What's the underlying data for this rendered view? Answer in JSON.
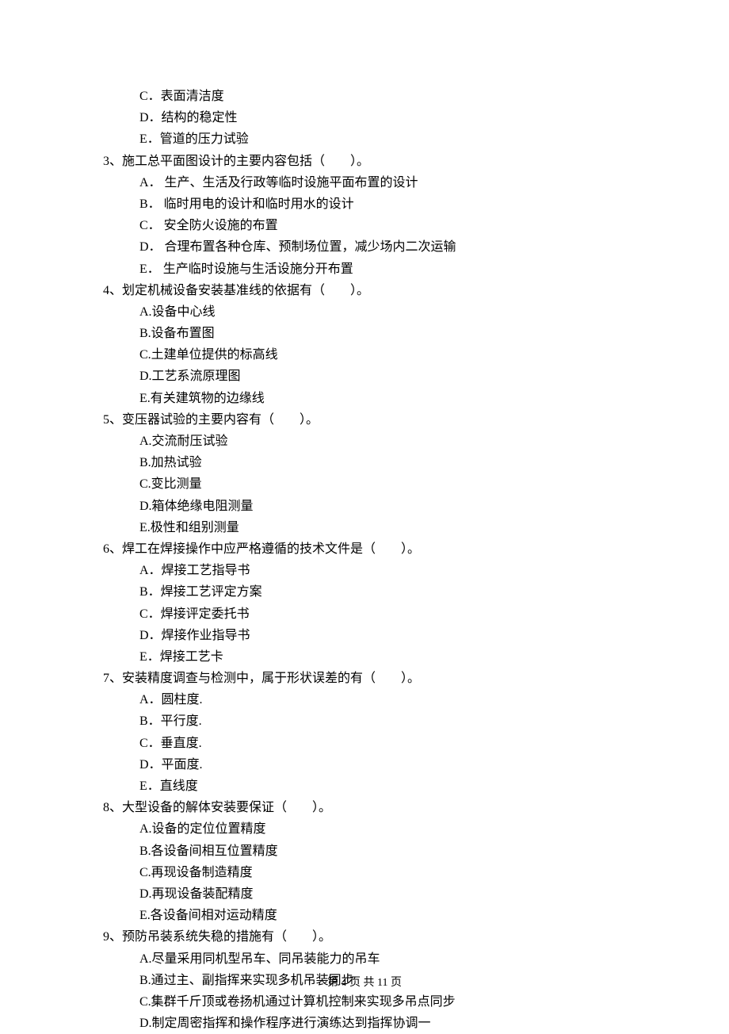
{
  "lines": {
    "opt_2c": "C．表面清洁度",
    "opt_2d": "D．结构的稳定性",
    "opt_2e": "E．管道的压力试验",
    "q3": "3、施工总平面图设计的主要内容包括（　　）。",
    "opt_3a": "A． 生产、生活及行政等临时设施平面布置的设计",
    "opt_3b": "B． 临时用电的设计和临时用水的设计",
    "opt_3c": "C． 安全防火设施的布置",
    "opt_3d": "D． 合理布置各种仓库、预制场位置，减少场内二次运输",
    "opt_3e": "E． 生产临时设施与生活设施分开布置",
    "q4": "4、划定机械设备安装基准线的依据有（　　）。",
    "opt_4a": "A.设备中心线",
    "opt_4b": "B.设备布置图",
    "opt_4c": "C.土建单位提供的标高线",
    "opt_4d": "D.工艺系流原理图",
    "opt_4e": "E.有关建筑物的边缘线",
    "q5": "5、变压器试验的主要内容有（　　）。",
    "opt_5a": "A.交流耐压试验",
    "opt_5b": "B.加热试验",
    "opt_5c": "C.变比测量",
    "opt_5d": "D.箱体绝缘电阻测量",
    "opt_5e": "E.极性和组别测量",
    "q6": "6、焊工在焊接操作中应严格遵循的技术文件是（　　）。",
    "opt_6a": "A．焊接工艺指导书",
    "opt_6b": "B．焊接工艺评定方案",
    "opt_6c": "C．焊接评定委托书",
    "opt_6d": "D．焊接作业指导书",
    "opt_6e": "E．焊接工艺卡",
    "q7": "7、安装精度调查与检测中，属于形状误差的有（　　）。",
    "opt_7a": "A．圆柱度.",
    "opt_7b": "B．平行度.",
    "opt_7c": "C．垂直度.",
    "opt_7d": "D．平面度.",
    "opt_7e": "E．直线度",
    "q8": "8、大型设备的解体安装要保证（　　）。",
    "opt_8a": "A.设备的定位位置精度",
    "opt_8b": "B.各设备间相互位置精度",
    "opt_8c": "C.再现设备制造精度",
    "opt_8d": "D.再现设备装配精度",
    "opt_8e": "E.各设备间相对运动精度",
    "q9": "9、预防吊装系统失稳的措施有（　　）。",
    "opt_9a": "A.尽量采用同机型吊车、同吊装能力的吊车",
    "opt_9b": "B.通过主、副指挥来实现多机吊装同步",
    "opt_9c": "C.集群千斤顶或卷扬机通过计算机控制来实现多吊点同步",
    "opt_9d": "D.制定周密指挥和操作程序进行演练达到指挥协调一"
  },
  "footer": "第 4 页 共 11 页"
}
